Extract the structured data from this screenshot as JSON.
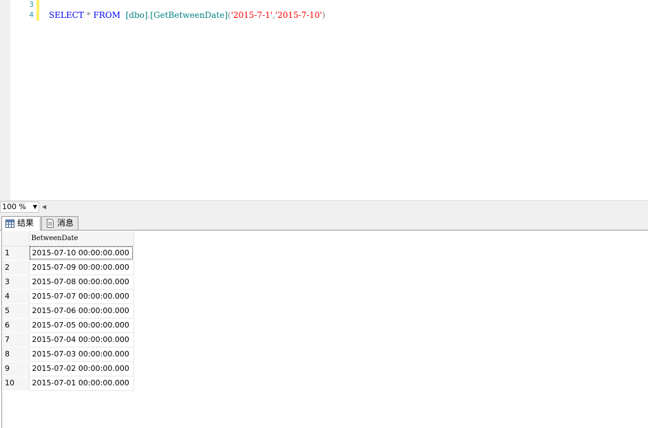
{
  "editor": {
    "lines": [
      {
        "number": "3",
        "tokens": []
      },
      {
        "number": "4",
        "tokens": [
          {
            "text": "SELECT",
            "kind": "kw"
          },
          {
            "text": " ",
            "kind": "plain"
          },
          {
            "text": "*",
            "kind": "op"
          },
          {
            "text": " ",
            "kind": "plain"
          },
          {
            "text": "FROM",
            "kind": "kw"
          },
          {
            "text": "  ",
            "kind": "plain"
          },
          {
            "text": "[dbo]",
            "kind": "ident"
          },
          {
            "text": ".",
            "kind": "op"
          },
          {
            "text": "[GetBetweenDate]",
            "kind": "ident"
          },
          {
            "text": "(",
            "kind": "op"
          },
          {
            "text": "'2015-7-1'",
            "kind": "str"
          },
          {
            "text": ",",
            "kind": "op"
          },
          {
            "text": "'2015-7-10'",
            "kind": "str"
          },
          {
            "text": ")",
            "kind": "op"
          }
        ]
      }
    ]
  },
  "zoom": {
    "value": "100 %"
  },
  "results": {
    "tabs": [
      {
        "label": "结果",
        "icon": "grid-icon",
        "active": true
      },
      {
        "label": "消息",
        "icon": "message-icon",
        "active": false
      }
    ],
    "column": "BetweenDate",
    "rows": [
      {
        "num": "1",
        "value": "2015-07-10 00:00:00.000"
      },
      {
        "num": "2",
        "value": "2015-07-09 00:00:00.000"
      },
      {
        "num": "3",
        "value": "2015-07-08 00:00:00.000"
      },
      {
        "num": "4",
        "value": "2015-07-07 00:00:00.000"
      },
      {
        "num": "5",
        "value": "2015-07-06 00:00:00.000"
      },
      {
        "num": "6",
        "value": "2015-07-05 00:00:00.000"
      },
      {
        "num": "7",
        "value": "2015-07-04 00:00:00.000"
      },
      {
        "num": "8",
        "value": "2015-07-03 00:00:00.000"
      },
      {
        "num": "9",
        "value": "2015-07-02 00:00:00.000"
      },
      {
        "num": "10",
        "value": "2015-07-01 00:00:00.000"
      }
    ]
  },
  "colors": {
    "keyword": "#0000ff",
    "identifier": "#008080",
    "string": "#ff0000",
    "operator": "#808080",
    "line_number": "#2b91af",
    "change_marker": "#ffee62"
  }
}
